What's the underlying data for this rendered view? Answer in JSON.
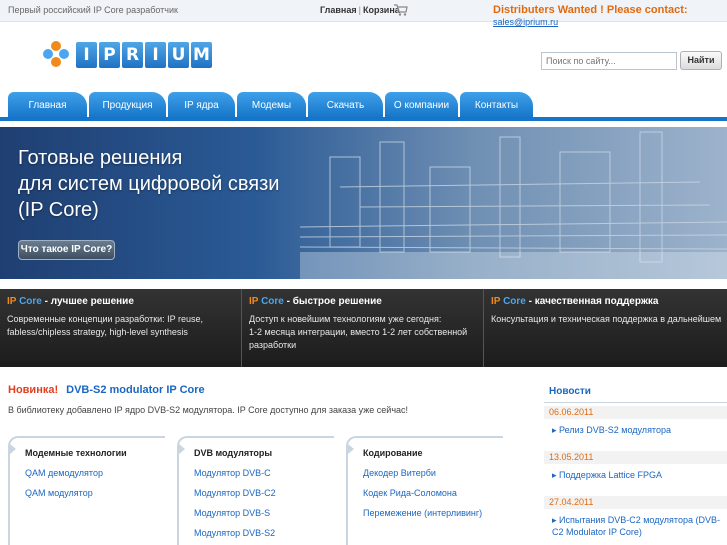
{
  "topbar": {
    "tagline": "Первый российский IP Core разработчик",
    "home_link": "Главная",
    "separator": "|",
    "cart_link": "Корзина",
    "cart_icon": "cart-icon",
    "distributors_text": "Distributers Wanted ! Please contact:",
    "email": "sales@iprium.ru"
  },
  "header": {
    "logo_letters": [
      "I",
      "P",
      "R",
      "I",
      "U",
      "M"
    ],
    "search_placeholder": "Поиск по сайту...",
    "search_button": "Найти"
  },
  "nav": {
    "tabs": [
      {
        "label": "Главная"
      },
      {
        "label": "Продукция"
      },
      {
        "label": "IP ядра"
      },
      {
        "label": "Модемы"
      },
      {
        "label": "Скачать"
      },
      {
        "label": "О компании"
      },
      {
        "label": "Контакты"
      }
    ]
  },
  "hero": {
    "line1": "Готовые решения",
    "line2": "для систем цифровой связи",
    "line3": "(IP Core)",
    "button": "Что такое IP Core?"
  },
  "features": [
    {
      "ip": "IP",
      "core": "Core",
      "title_rest": " - лучшее решение",
      "desc1": "Современные концепции разработки: IP reuse,",
      "desc2": "fabless/chipless strategy, high-level synthesis",
      "desc3": ""
    },
    {
      "ip": "IP",
      "core": "Core",
      "title_rest": " - быстрое решение",
      "desc1": "Доступ к новейшим технологиям уже сегодня:",
      "desc2": "1-2 месяца интеграции, вместо 1-2 лет собственной",
      "desc3": "разработки"
    },
    {
      "ip": "IP",
      "core": "Core",
      "title_rest": " - качественная поддержка",
      "desc1": "Консультация и техническая поддержка в дальнейшем",
      "desc2": "",
      "desc3": ""
    }
  ],
  "news_main": {
    "label": "Новинка!",
    "link": "DVB-S2 modulator IP Core",
    "desc": "В библиотеку добавлено IP ядро DVB-S2 модулятора. IP Core доступно для заказа уже сейчас!"
  },
  "boxes": [
    {
      "title": "Модемные технологии",
      "items": [
        "QAM демодулятор",
        "QAM модулятор"
      ]
    },
    {
      "title": "DVB модуляторы",
      "items": [
        "Модулятор DVB-C",
        "Модулятор DVB-C2",
        "Модулятор DVB-S",
        "Модулятор DVB-S2"
      ]
    },
    {
      "title": "Кодирование",
      "items": [
        "Декодер Витерби",
        "Кодек Рида-Соломона",
        "Перемежение (интерливинг)"
      ]
    }
  ],
  "sidebar": {
    "title": "Новости",
    "news": [
      {
        "date": "06.06.2011",
        "text": "Релиз DVB-S2 модулятора"
      },
      {
        "date": "13.05.2011",
        "text": "Поддержка Lattice FPGA"
      },
      {
        "date": "27.04.2011",
        "text": "Испытания DVB-C2 модулятора (DVB-C2 Modulator IP Core)"
      }
    ]
  },
  "colors": {
    "accent_blue": "#1a66c2",
    "nav_blue": "#1675c8",
    "orange": "#e06a10"
  }
}
